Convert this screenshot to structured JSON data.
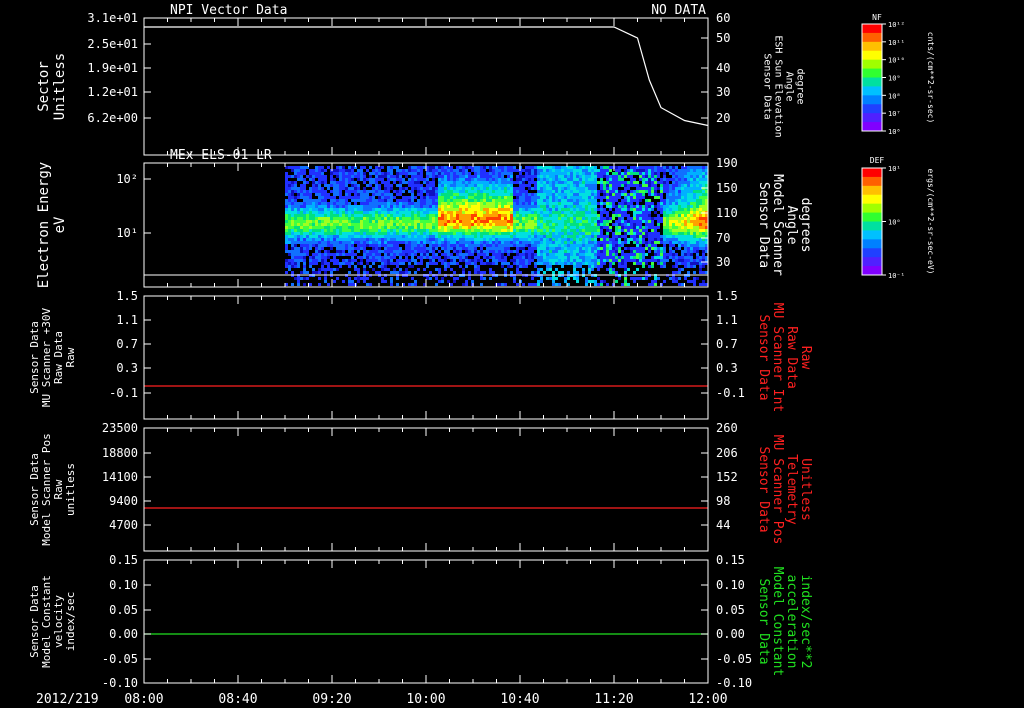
{
  "title_left": "NPI Vector Data",
  "title_right": "NO DATA",
  "date_label": "2012/219",
  "time_ticks": [
    "08:00",
    "08:40",
    "09:20",
    "10:00",
    "10:40",
    "11:20",
    "12:00"
  ],
  "colors": {
    "white": "#ffffff",
    "red": "#ff2020",
    "green": "#20e020",
    "background": "#000000"
  },
  "panels": [
    {
      "id": "p1",
      "title": "",
      "left_label": [
        "Sector",
        "Unitless"
      ],
      "left_ticks": [
        "3.1e+01",
        "2.5e+01",
        "1.9e+01",
        "1.2e+01",
        "6.2e+00"
      ],
      "right_label": [
        "Sensor Data",
        "ESH Sun Elevation",
        "Angle",
        "degree"
      ],
      "right_label_color": "white",
      "right_ticks": [
        "60",
        "50",
        "40",
        "30",
        "20"
      ]
    },
    {
      "id": "p2",
      "title": "MEx ELS-01 LR",
      "left_label": [
        "Electron Energy",
        "eV"
      ],
      "left_ticks": [
        "10²",
        "10¹"
      ],
      "right_label": [
        "Sensor Data",
        "Model Scanner",
        "Angle",
        "degrees"
      ],
      "right_label_color": "white",
      "right_ticks": [
        "190",
        "150",
        "110",
        "70",
        "30"
      ]
    },
    {
      "id": "p3",
      "title": "",
      "left_label": [
        "Sensor Data",
        "MU Scanner +30V",
        "Raw Data",
        "Raw"
      ],
      "left_ticks": [
        "1.5",
        "1.1",
        "0.7",
        "0.3",
        "-0.1"
      ],
      "right_label": [
        "Sensor Data",
        "MU Scanner Int",
        "Raw Data",
        "Raw"
      ],
      "right_label_color": "red",
      "right_ticks": [
        "1.5",
        "1.1",
        "0.7",
        "0.3",
        "-0.1"
      ]
    },
    {
      "id": "p4",
      "title": "",
      "left_label": [
        "Sensor Data",
        "Model Scanner Pos",
        "Raw",
        "unitless"
      ],
      "left_ticks": [
        "23500",
        "18800",
        "14100",
        "9400",
        "4700"
      ],
      "right_label": [
        "Sensor Data",
        "MU Scanner Pos",
        "Telemetry",
        "Unitless"
      ],
      "right_label_color": "red",
      "right_ticks": [
        "260",
        "206",
        "152",
        "98",
        "44"
      ]
    },
    {
      "id": "p5",
      "title": "",
      "left_label": [
        "Sensor Data",
        "Model Constant",
        "velocity",
        "index/sec"
      ],
      "left_ticks": [
        "0.15",
        "0.10",
        "0.05",
        "0.00",
        "-0.05",
        "-0.10"
      ],
      "right_label": [
        "Sensor Data",
        "Model Constant",
        "acceleration",
        "index/sec**2"
      ],
      "right_label_color": "green",
      "right_ticks": [
        "0.15",
        "0.10",
        "0.05",
        "0.00",
        "-0.05",
        "-0.10"
      ]
    }
  ],
  "colorbars": [
    {
      "id": "cb1",
      "title": "NF",
      "unit": "cnts/(cm**2-sr-sec)",
      "ticks": [
        "10¹²",
        "10¹¹",
        "10¹⁰",
        "10⁹",
        "10⁸",
        "10⁷",
        "10⁶"
      ]
    },
    {
      "id": "cb2",
      "title": "DEF",
      "unit": "ergs/(cm**2-sr-sec-eV)",
      "ticks": [
        "10¹",
        "10⁰",
        "10⁻¹"
      ]
    }
  ],
  "chart_data": [
    {
      "type": "line",
      "panel": "p1",
      "xlabel": "",
      "ylabel": "Sensor Data ESH Sun Elevation Angle degree",
      "ylim": [
        11,
        60
      ],
      "x": [
        "08:00",
        "10:00",
        "11:00",
        "11:20",
        "11:30",
        "11:35",
        "11:40",
        "11:50",
        "12:00"
      ],
      "series": [
        {
          "values": [
            57,
            57,
            57,
            57,
            50,
            35,
            24,
            19,
            17
          ]
        }
      ]
    },
    {
      "type": "heatmap",
      "panel": "p2",
      "title": "MEx ELS-01 LR",
      "ylabel": "Electron Energy eV",
      "note": "spectrogram DEF; data present from 09:00 to 12:00, intense red at 10:05-10:35 and 11:42-12:00",
      "reference_line": {
        "axis": "right",
        "value": 10
      }
    },
    {
      "type": "line",
      "panel": "p3",
      "ylim": [
        -0.1,
        1.5
      ],
      "x": [
        "08:00",
        "12:00"
      ],
      "series": [
        {
          "values": [
            0.0,
            0.0
          ]
        }
      ]
    },
    {
      "type": "line",
      "panel": "p4",
      "ylim": [
        0,
        23500
      ],
      "x": [
        "08:00",
        "12:00"
      ],
      "series": [
        {
          "values": [
            7900,
            7900
          ]
        }
      ]
    },
    {
      "type": "line",
      "panel": "p5",
      "ylim": [
        -0.1,
        0.15
      ],
      "x": [
        "08:00",
        "12:00"
      ],
      "series": [
        {
          "values": [
            0.0,
            0.0
          ]
        }
      ]
    }
  ]
}
